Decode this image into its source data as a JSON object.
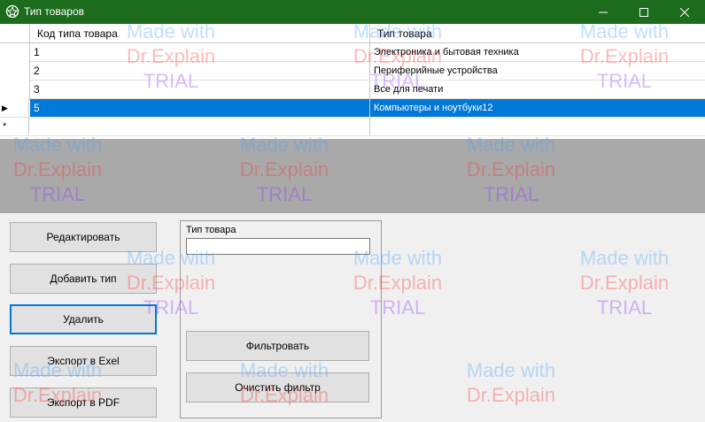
{
  "window": {
    "title": "Тип товаров"
  },
  "grid": {
    "columns": [
      "Код типа товара",
      "Тип товара"
    ],
    "rows": [
      {
        "code": "1",
        "type": "Электроника и бытовая техника"
      },
      {
        "code": "2",
        "type": "Периферийные устройства"
      },
      {
        "code": "3",
        "type": "Все для печати"
      },
      {
        "code": "5",
        "type": "Компьютеры и ноутбуки12"
      }
    ],
    "new_row_marker": "*",
    "current_row_marker": "▶"
  },
  "buttons": {
    "edit": "Редактировать",
    "add": "Добавить тип",
    "delete": "Удалить",
    "export_excel": "Экспорт в Exel",
    "export_pdf": "Экспорт в PDF"
  },
  "filter": {
    "label": "Тип товара",
    "value": "",
    "apply": "Фильтровать",
    "clear": "Очистить фильтр"
  },
  "watermark": {
    "line1": "Made with",
    "line2": "Dr.Explain",
    "line3": "TRIAL"
  }
}
